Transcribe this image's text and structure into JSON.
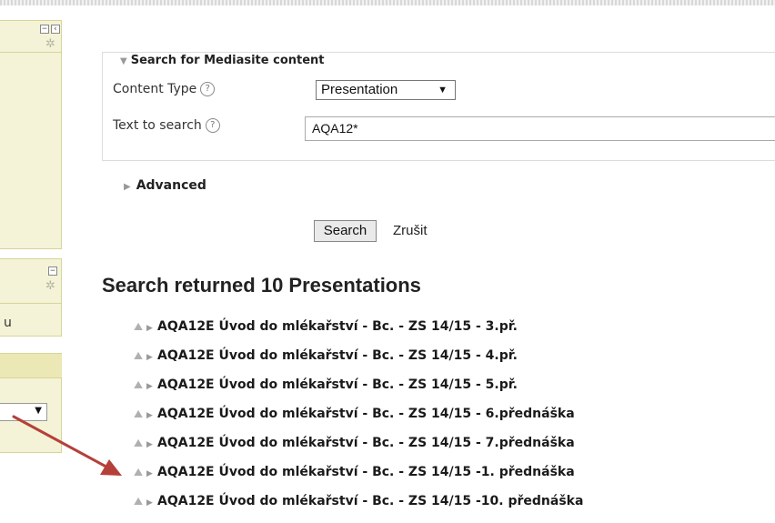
{
  "search_form": {
    "legend": "Search for Mediasite content",
    "content_type_label": "Content Type",
    "content_type_value": "Presentation",
    "text_label": "Text to search",
    "text_value": "AQA12*",
    "help_glyph": "?",
    "advanced_label": "Advanced",
    "search_button": "Search",
    "cancel_label": "Zrušit"
  },
  "sidebar": {
    "partial_text": "u"
  },
  "results": {
    "title": "Search returned 10 Presentations",
    "items": [
      "AQA12E Úvod do mlékařství - Bc. - ZS 14/15 - 3.př.",
      "AQA12E Úvod do mlékařství - Bc. - ZS 14/15 - 4.př.",
      "AQA12E Úvod do mlékařství - Bc. - ZS 14/15 - 5.př.",
      "AQA12E Úvod do mlékařství - Bc. - ZS 14/15 - 6.přednáška",
      "AQA12E Úvod do mlékařství - Bc. - ZS 14/15 - 7.přednáška",
      "AQA12E Úvod do mlékařství - Bc. - ZS 14/15 -1. přednáška",
      "AQA12E Úvod do mlékařství - Bc. - ZS 14/15 -10. přednáška"
    ]
  },
  "colors": {
    "annotation_arrow": "#b5403a",
    "sidebar_bg": "#f4f3d7"
  }
}
